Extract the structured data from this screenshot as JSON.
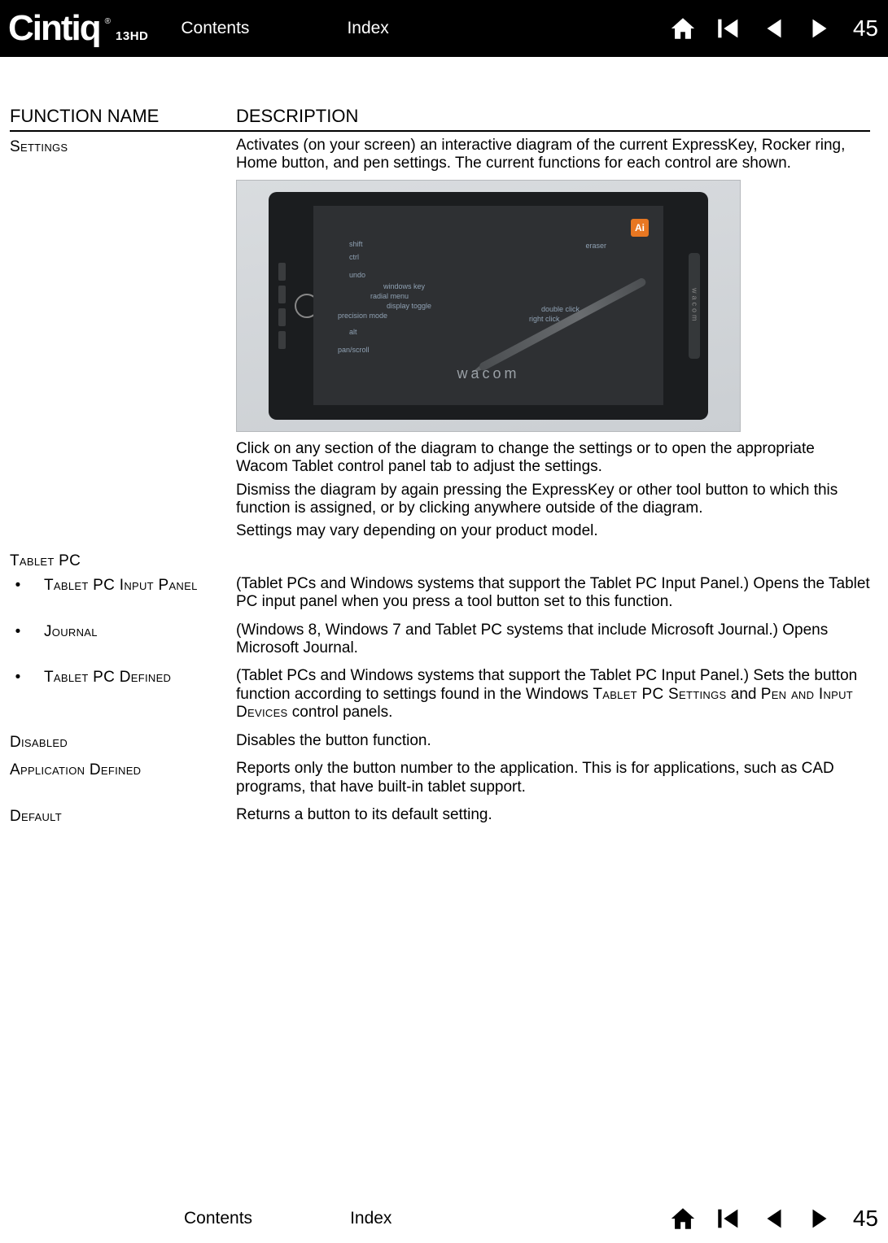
{
  "header": {
    "logo_main": "Cintiq",
    "logo_reg": "®",
    "logo_sub": "13HD",
    "contents": "Contents",
    "index": "Index",
    "page": "45"
  },
  "footer": {
    "contents": "Contents",
    "index": "Index",
    "page": "45"
  },
  "table": {
    "head_name": "FUNCTION NAME",
    "head_desc": "DESCRIPTION"
  },
  "rows": {
    "settings": {
      "name": "Settings",
      "p1": "Activates (on your screen) an interactive diagram of the current ExpressKey, Rocker ring, Home button, and pen settings. The current functions for each control are shown.",
      "p2": "Click on any section of the diagram to change the settings or to open the appropriate Wacom Tablet control panel tab to adjust the settings.",
      "p3": "Dismiss the diagram by again pressing the ExpressKey or other tool button to which this function is assigned, or by clicking anywhere outside of the diagram.",
      "p4": "Settings may vary depending on your product model."
    },
    "tabletpc_header": "Tablet PC",
    "tabletpc_input": {
      "name": "Tablet PC Input Panel",
      "desc": "(Tablet PCs and Windows systems that support the Tablet PC Input Panel.) Opens the Tablet PC input panel when you press a tool button set to this function."
    },
    "journal": {
      "name": "Journal",
      "desc_pre": "(Windows 8,",
      "desc_post": " Windows 7 and Tablet PC systems that include Microsoft Journal.) Opens Microsoft Journal."
    },
    "tabletpc_defined": {
      "name": "Tablet PC Defined",
      "desc_a": "(Tablet PCs and Windows systems that support the Tablet PC Input Panel.) Sets the button function according to settings found in the Windows ",
      "sc1": "Tablet PC Settings",
      "desc_b": " and ",
      "sc2": "Pen and Input Devices",
      "desc_c": " control panels."
    },
    "disabled": {
      "name": "Disabled",
      "desc": "Disables the button function."
    },
    "app_defined": {
      "name": "Application Defined",
      "desc": "Reports only the button number to the application. This is for applications, such as CAD programs, that have built-in tablet support."
    },
    "default": {
      "name": "Default",
      "desc": "Returns a button to its default setting."
    }
  },
  "diagram": {
    "wacom": "wacom",
    "side_text": "wacom",
    "ai": "Ai",
    "labels": {
      "shift": "shift",
      "ctrl": "ctrl",
      "undo": "undo",
      "windows_key": "windows key",
      "radial_menu": "radial menu",
      "display_toggle": "display toggle",
      "precision_mode": "precision mode",
      "alt": "alt",
      "pan_scroll": "pan/scroll",
      "eraser": "eraser",
      "double_click": "double click",
      "right_click": "right click"
    }
  }
}
